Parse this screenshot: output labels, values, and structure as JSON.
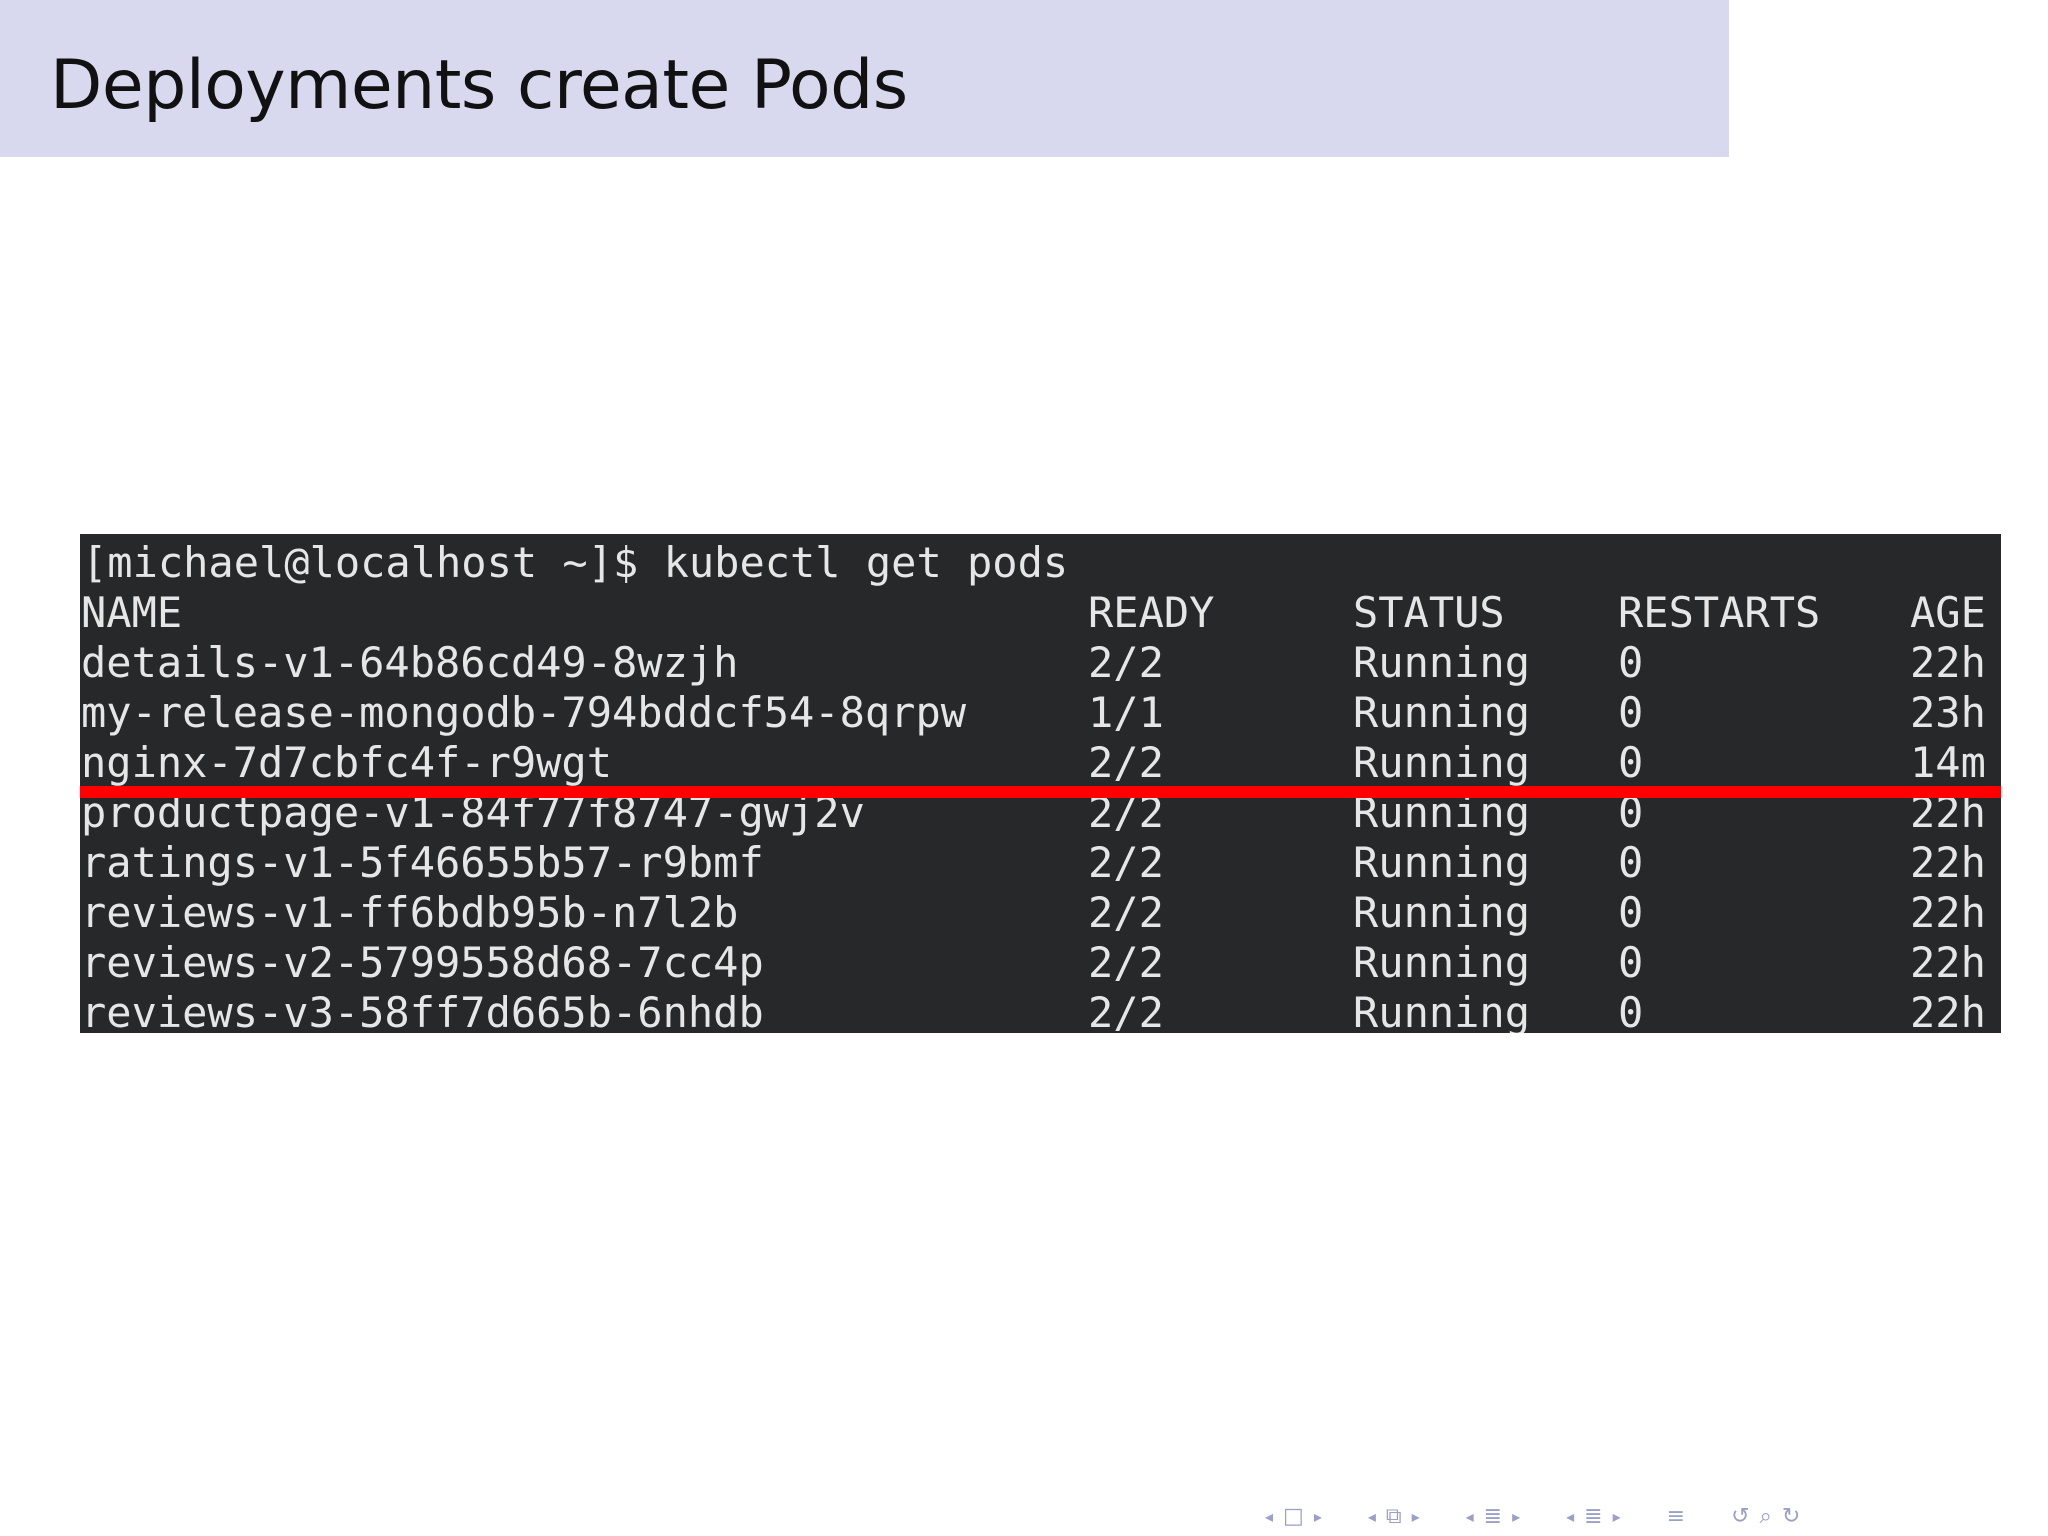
{
  "slide": {
    "title": "Deployments create Pods"
  },
  "terminal": {
    "prompt": "[michael@localhost ~]$ kubectl get pods",
    "columns": {
      "name": "NAME",
      "ready": "READY",
      "status": "STATUS",
      "restarts": "RESTARTS",
      "age": "AGE"
    },
    "rows": [
      {
        "name": "details-v1-64b86cd49-8wzjh",
        "ready": "2/2",
        "status": "Running",
        "restarts": "0",
        "age": "22h"
      },
      {
        "name": "my-release-mongodb-794bddcf54-8qrpw",
        "ready": "1/1",
        "status": "Running",
        "restarts": "0",
        "age": "23h"
      },
      {
        "name": "nginx-7d7cbfc4f-r9wgt",
        "ready": "2/2",
        "status": "Running",
        "restarts": "0",
        "age": "14m"
      },
      {
        "name": "productpage-v1-84f77f8747-gwj2v",
        "ready": "2/2",
        "status": "Running",
        "restarts": "0",
        "age": "22h"
      },
      {
        "name": "ratings-v1-5f46655b57-r9bmf",
        "ready": "2/2",
        "status": "Running",
        "restarts": "0",
        "age": "22h"
      },
      {
        "name": "reviews-v1-ff6bdb95b-n7l2b",
        "ready": "2/2",
        "status": "Running",
        "restarts": "0",
        "age": "22h"
      },
      {
        "name": "reviews-v2-5799558d68-7cc4p",
        "ready": "2/2",
        "status": "Running",
        "restarts": "0",
        "age": "22h"
      },
      {
        "name": "reviews-v3-58ff7d665b-6nhdb",
        "ready": "2/2",
        "status": "Running",
        "restarts": "0",
        "age": "22h"
      }
    ],
    "highlight_color": "#ff0000",
    "background_color": "#262829"
  },
  "navigation": {
    "icons": [
      "prev-frame-icon",
      "frame-icon",
      "next-frame-icon",
      "prev-subsection-icon",
      "subsection-icon",
      "next-subsection-icon",
      "prev-section-icon",
      "section-icon",
      "next-section-icon",
      "prev-slide-group-icon",
      "slide-group-icon",
      "next-slide-group-icon",
      "align-icon",
      "undo-icon",
      "search-icon",
      "redo-icon"
    ]
  }
}
